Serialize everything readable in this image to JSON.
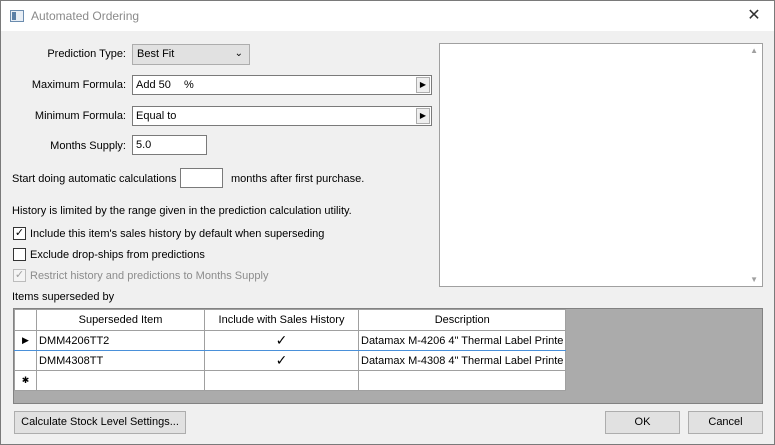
{
  "window": {
    "title": "Automated Ordering",
    "close_glyph": "✕"
  },
  "form": {
    "prediction_type": {
      "label": "Prediction Type:",
      "value": "Best Fit"
    },
    "maximum_formula": {
      "label": "Maximum Formula:",
      "value": "Add 50",
      "unit": "%"
    },
    "minimum_formula": {
      "label": "Minimum Formula:",
      "value": "Equal to"
    },
    "months_supply": {
      "label": "Months Supply:",
      "value": "5.0"
    },
    "start_calc": {
      "prefix": "Start doing automatic calculations",
      "value": "",
      "suffix": "months after first purchase."
    },
    "history_note": "History is limited by the range given in the prediction calculation utility.",
    "checkboxes": [
      {
        "label": "Include this item's sales history by default when superseding",
        "checked": true,
        "disabled": false
      },
      {
        "label": "Exclude drop-ships from predictions",
        "checked": false,
        "disabled": false
      },
      {
        "label": "Restrict history and predictions to Months Supply",
        "checked": true,
        "disabled": true
      }
    ]
  },
  "superseded": {
    "label": "Items superseded by",
    "columns": [
      "Superseded Item",
      "Include with Sales History",
      "Description"
    ],
    "rows": [
      {
        "item": "DMM4206TT2",
        "include": "✓",
        "description": "Datamax M-4206 4\" Thermal Label Printe"
      },
      {
        "item": "DMM4308TT",
        "include": "✓",
        "description": "Datamax M-4308 4\" Thermal Label Printe"
      }
    ],
    "new_row_marker": "✱",
    "current_marker": "▶"
  },
  "buttons": {
    "calculate": "Calculate Stock Level Settings...",
    "ok": "OK",
    "cancel": "Cancel"
  }
}
